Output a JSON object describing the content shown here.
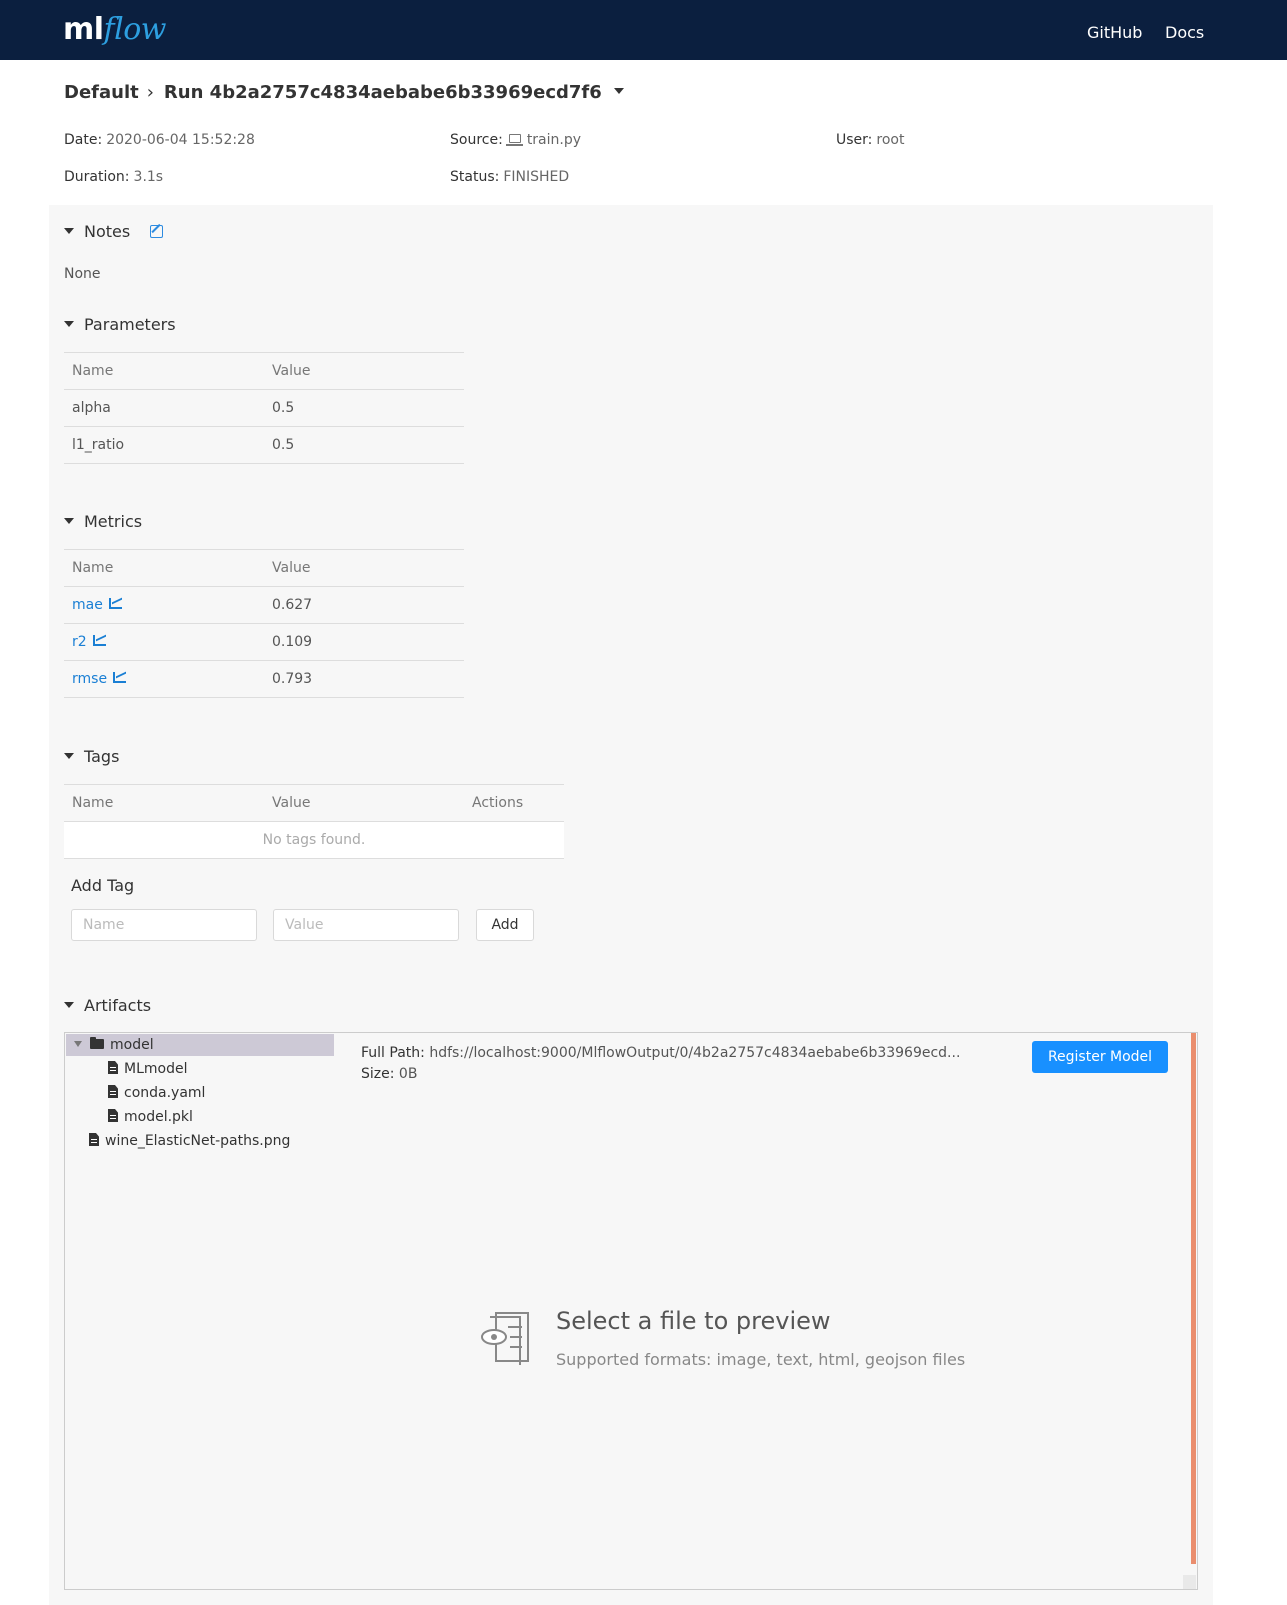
{
  "header": {
    "logo_ml": "ml",
    "logo_flow": "flow",
    "nav": {
      "github": "GitHub",
      "docs": "Docs"
    }
  },
  "breadcrumb": {
    "experiment": "Default",
    "run": "Run 4b2a2757c4834aebabe6b33969ecd7f6"
  },
  "run_meta": {
    "date_label": "Date:",
    "date": "2020-06-04 15:52:28",
    "source_label": "Source:",
    "source": "train.py",
    "user_label": "User:",
    "user": "root",
    "duration_label": "Duration:",
    "duration": "3.1s",
    "status_label": "Status:",
    "status": "FINISHED"
  },
  "notes": {
    "title": "Notes",
    "text": "None"
  },
  "parameters": {
    "title": "Parameters",
    "columns": [
      "Name",
      "Value"
    ],
    "rows": [
      {
        "name": "alpha",
        "value": "0.5"
      },
      {
        "name": "l1_ratio",
        "value": "0.5"
      }
    ]
  },
  "metrics": {
    "title": "Metrics",
    "columns": [
      "Name",
      "Value"
    ],
    "rows": [
      {
        "name": "mae",
        "value": "0.627"
      },
      {
        "name": "r2",
        "value": "0.109"
      },
      {
        "name": "rmse",
        "value": "0.793"
      }
    ]
  },
  "tags": {
    "title": "Tags",
    "columns": [
      "Name",
      "Value",
      "Actions"
    ],
    "empty_text": "No tags found.",
    "add_title": "Add Tag",
    "name_placeholder": "Name",
    "value_placeholder": "Value",
    "add_button": "Add"
  },
  "artifacts": {
    "title": "Artifacts",
    "tree": {
      "folder": "model",
      "children": [
        "MLmodel",
        "conda.yaml",
        "model.pkl"
      ],
      "root_file": "wine_ElasticNet-paths.png"
    },
    "full_path_label": "Full Path:",
    "full_path": "hdfs://localhost:9000/MlflowOutput/0/4b2a2757c4834aebabe6b33969ecd...",
    "size_label": "Size:",
    "size": "0B",
    "register_button": "Register Model",
    "preview_title": "Select a file to preview",
    "preview_subtitle": "Supported formats: image, text, html, geojson files"
  },
  "colors": {
    "navbar": "#0b1f3f",
    "accent": "#1890ff",
    "link": "#1a7fd4",
    "selected_tree": "#cdc9d6",
    "panel_bg": "#f7f7f7"
  }
}
